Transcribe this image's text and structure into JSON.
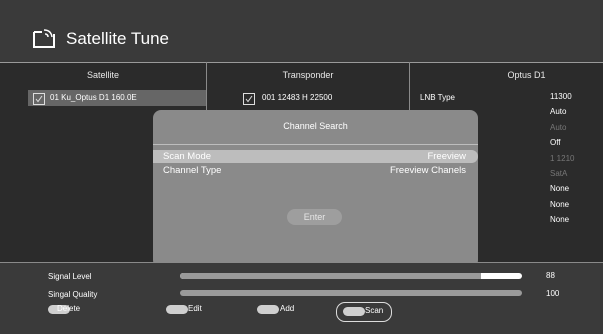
{
  "header": {
    "title": "Satellite Tune",
    "icon": "satellite-dish-icon"
  },
  "columns": {
    "satellite": "Satellite",
    "transponder": "Transponder",
    "settings": "Optus D1"
  },
  "satellite_list": [
    {
      "label": "01 Ku_Optus D1 160.0E",
      "checked": true
    }
  ],
  "transponder_list": [
    {
      "label": "001  12483 H 22500",
      "checked": true
    }
  ],
  "settings": {
    "lnb_type_label": "LNB Type",
    "values": [
      {
        "text": "11300",
        "dim": false
      },
      {
        "text": "Auto",
        "dim": false
      },
      {
        "text": "Auto",
        "dim": true
      },
      {
        "text": "Off",
        "dim": false
      },
      {
        "text": "1 1210",
        "dim": true
      },
      {
        "text": "SatA",
        "dim": true
      },
      {
        "text": "None",
        "dim": false
      },
      {
        "text": "None",
        "dim": false
      },
      {
        "text": "None",
        "dim": false
      }
    ]
  },
  "dialog": {
    "title": "Channel Search",
    "options": [
      {
        "label": "Scan Mode",
        "value": "Freeview",
        "selected": true
      },
      {
        "label": "Channel Type",
        "value": "Freeview Chanels",
        "selected": false
      }
    ],
    "enter_label": "Enter"
  },
  "signal": {
    "level_label": "Signal Level",
    "level_value": "88",
    "level_fraction": 0.88,
    "quality_label": "Singal Quality",
    "quality_value": "100",
    "quality_fraction": 1.0
  },
  "keys": [
    {
      "label": "Delete",
      "color": "red"
    },
    {
      "label": "Edit",
      "color": "green"
    },
    {
      "label": "Add",
      "color": "yellow"
    },
    {
      "label": "Scan",
      "color": "blue"
    }
  ]
}
